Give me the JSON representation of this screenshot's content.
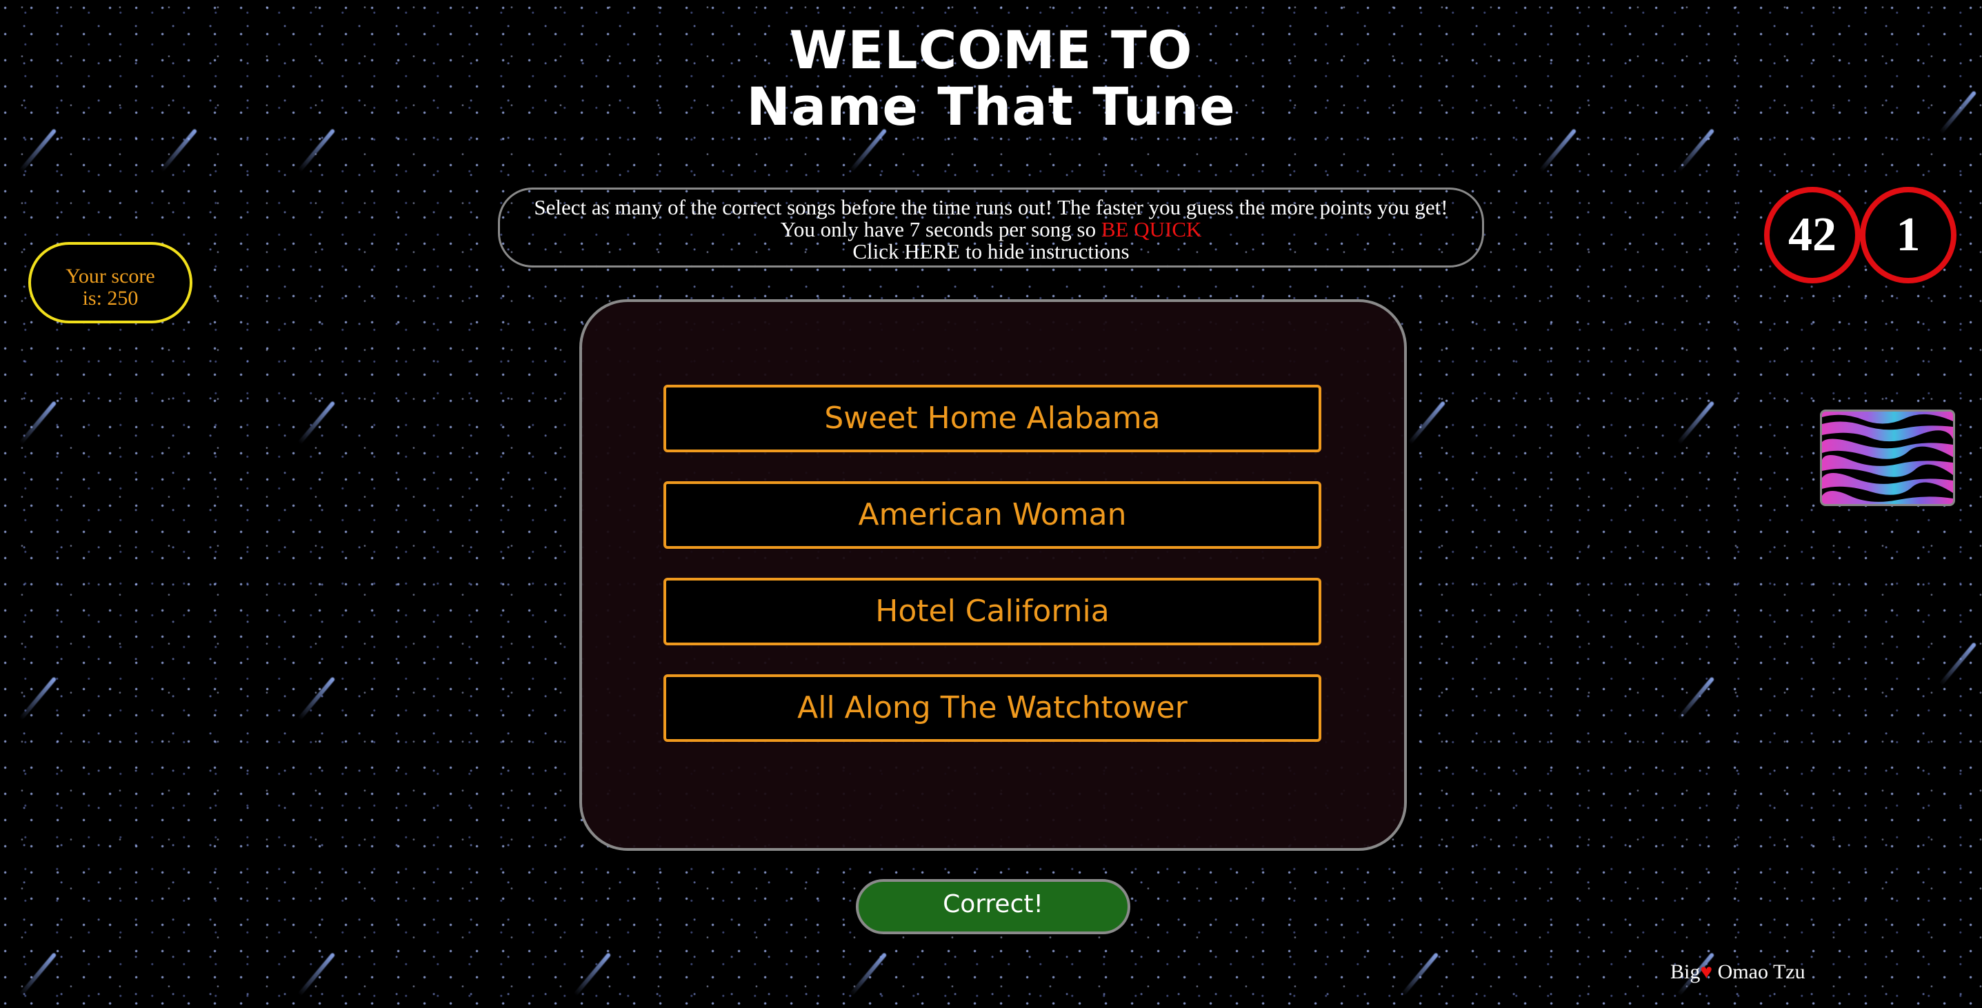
{
  "header": {
    "title_line1": "WELCOME TO",
    "title_line2": "Name That Tune"
  },
  "instructions": {
    "line1": "Select as many of the correct songs before the time runs out! The faster you guess the more points you get!",
    "line2_prefix": "You only have 7 seconds per song so ",
    "line2_emphasis": "BE QUICK",
    "line3": "Click HERE to hide instructions",
    "emphasis_color": "#e11111"
  },
  "score": {
    "line1": "Your score",
    "line2": "is: 250"
  },
  "counters": {
    "left": "42",
    "right": "1"
  },
  "choices": [
    {
      "label": "Sweet Home Alabama"
    },
    {
      "label": "American Woman"
    },
    {
      "label": "Hotel California"
    },
    {
      "label": "All Along The Watchtower"
    }
  ],
  "feedback_button": {
    "label": "Correct!"
  },
  "credit": {
    "prefix": "Big",
    "heart": "♥",
    "suffix": " Omao Tzu"
  },
  "colors": {
    "accent_orange": "#f09a1e",
    "score_border": "#f2e01c",
    "counter_ring": "#e10d12",
    "correct_green": "#1d6b1a"
  },
  "icons": {
    "zebra_thumbnail": "zebra-pattern-image"
  }
}
